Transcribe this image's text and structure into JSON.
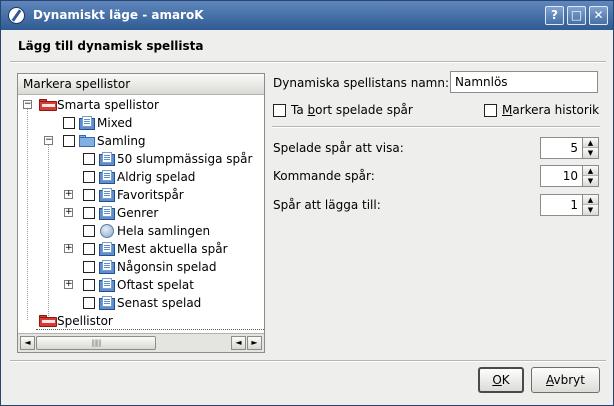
{
  "window": {
    "title": "Dynamiskt läge - amaroK",
    "help_button": "?",
    "min_button": "□",
    "close_button": "✕"
  },
  "dialog_heading": "Lägg till dynamisk spellista",
  "tree": {
    "header": "Markera spellistor",
    "items": [
      {
        "label": "Smarta spellistor",
        "expander": "−",
        "icon": "smart-playlist-folder-icon"
      },
      {
        "label": "Mixed",
        "icon": "smart-playlist-icon"
      },
      {
        "label": "Samling",
        "expander": "−",
        "icon": "folder-icon"
      },
      {
        "label": "50 slumpmässiga spår",
        "icon": "smart-playlist-icon"
      },
      {
        "label": "Aldrig spelad",
        "icon": "smart-playlist-icon"
      },
      {
        "label": "Favoritspår",
        "expander": "+",
        "icon": "smart-playlist-icon"
      },
      {
        "label": "Genrer",
        "expander": "+",
        "icon": "smart-playlist-icon"
      },
      {
        "label": "Hela samlingen",
        "icon": "collection-globe-icon"
      },
      {
        "label": "Mest aktuella spår",
        "expander": "+",
        "icon": "smart-playlist-icon"
      },
      {
        "label": "Någonsin spelad",
        "icon": "smart-playlist-icon"
      },
      {
        "label": "Oftast spelat",
        "expander": "+",
        "icon": "smart-playlist-icon"
      },
      {
        "label": "Senast spelad",
        "icon": "smart-playlist-icon"
      },
      {
        "label": "Spellistor",
        "icon": "playlist-folder-icon"
      }
    ],
    "scroll_left": "◄",
    "scroll_right": "►",
    "scroll_grip": "|||||||"
  },
  "form": {
    "name_label": "Dynamiska spellistans namn:",
    "name_value": "Namnlös",
    "remove_played_pre": "Ta ",
    "remove_played_underline": "b",
    "remove_played_post": "ort spelade spår",
    "mark_history_underline": "M",
    "mark_history_post": "arkera historik",
    "previous_label": "Spelade spår att visa:",
    "previous_value": "5",
    "upcoming_label": "Kommande spår:",
    "upcoming_value": "10",
    "append_label": "Spår att lägga till:",
    "append_value": "1",
    "spin_up": "▲",
    "spin_down": "▼"
  },
  "buttons": {
    "ok_underline": "O",
    "ok_post": "K",
    "cancel_underline": "A",
    "cancel_post": "vbryt"
  }
}
